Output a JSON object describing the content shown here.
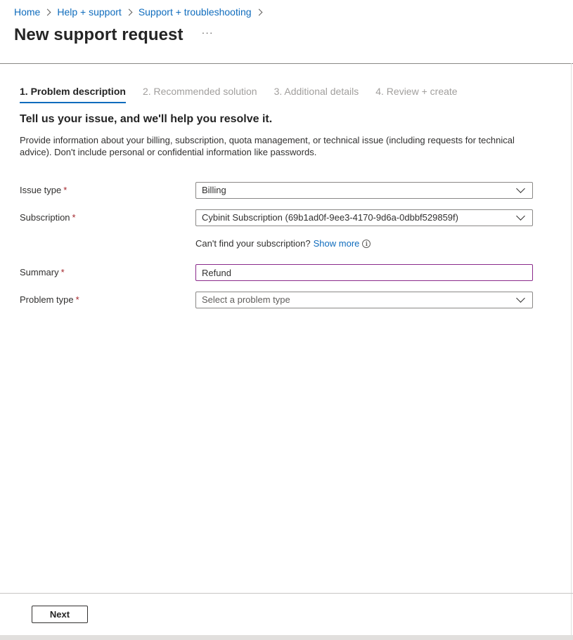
{
  "breadcrumb": {
    "items": [
      {
        "label": "Home"
      },
      {
        "label": "Help + support"
      },
      {
        "label": "Support + troubleshooting"
      }
    ]
  },
  "header": {
    "title": "New support request",
    "more_label": "···"
  },
  "tabs": [
    {
      "label": "1. Problem description",
      "active": true
    },
    {
      "label": "2. Recommended solution",
      "active": false
    },
    {
      "label": "3. Additional details",
      "active": false
    },
    {
      "label": "4. Review + create",
      "active": false
    }
  ],
  "section": {
    "heading": "Tell us your issue, and we'll help you resolve it.",
    "description": "Provide information about your billing, subscription, quota management, or technical issue (including requests for technical advice). Don't include personal or confidential information like passwords."
  },
  "form": {
    "required_marker": "*",
    "issue_type": {
      "label": "Issue type",
      "value": "Billing"
    },
    "subscription": {
      "label": "Subscription",
      "value": "Cybinit Subscription (69b1ad0f-9ee3-4170-9d6a-0dbbf529859f)"
    },
    "subscription_help": {
      "text": "Can't find your subscription?",
      "link": "Show more",
      "info_icon": "i"
    },
    "summary": {
      "label": "Summary",
      "value": "Refund"
    },
    "problem_type": {
      "label": "Problem type",
      "placeholder": "Select a problem type"
    }
  },
  "footer": {
    "next_label": "Next"
  },
  "colors": {
    "link": "#0f6cbd",
    "required": "#a4262c",
    "focused_input_border": "#8a2a8b"
  }
}
